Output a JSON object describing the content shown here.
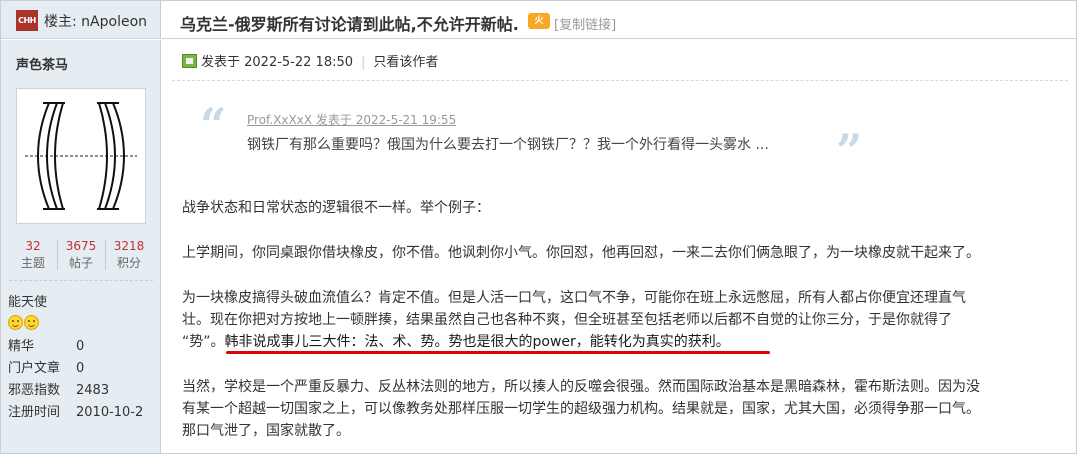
{
  "header": {
    "op_icon_text": "CHH",
    "op_label": "楼主: nApoleon",
    "thread_title": "乌克兰-俄罗斯所有讨论请到此帖,不允许开新帖.",
    "fire_icon_text": "火",
    "copy_link": "[复制链接]"
  },
  "author": {
    "name": "声色茶马",
    "stats": [
      {
        "value": "32",
        "label": "主题"
      },
      {
        "value": "3675",
        "label": "帖子"
      },
      {
        "value": "3218",
        "label": "积分"
      }
    ],
    "rank": "能天使",
    "info": [
      {
        "key": "精华",
        "value": "0"
      },
      {
        "key": "门户文章",
        "value": "0"
      },
      {
        "key": "邪恶指数",
        "value": "2483"
      },
      {
        "key": "注册时间",
        "value": "2010-10-2"
      }
    ]
  },
  "post": {
    "posted_at": "发表于 2022-5-22 18:50",
    "only_author": "只看该作者",
    "quote": {
      "author_line": "Prof.XxXxX 发表于 2022-5-21 19:55",
      "text": "钢铁厂有那么重要吗？俄国为什么要去打一个钢铁厂？？我一个外行看得一头雾水 ..."
    },
    "paragraphs": {
      "p1": "战争状态和日常状态的逻辑很不一样。举个例子：",
      "p2": "上学期间，你同桌跟你借块橡皮，你不借。他讽刺你小气。你回怼，他再回怼，一来二去你们俩急眼了，为一块橡皮就干起来了。",
      "p3_line1": "为一块橡皮搞得头破血流值么？肯定不值。但是人活一口气，这口气不争，可能你在班上永远憋屈，所有人都占你便宜还理直气",
      "p3_line2": "壮。现在你把对方按地上一顿胖揍，结果虽然自己也各种不爽，但全班甚至包括老师以后都不自觉的让你三分，于是你就得了",
      "p3_line3_a": "“势”。",
      "p3_line3_b": "韩非说成事儿三大件：法、术、势。势也是很大的power，能转化为真实的获利。",
      "p4_line1": "当然，学校是一个严重反暴力、反丛林法则的地方，所以揍人的反噬会很强。然而国际政治基本是黑暗森林，霍布斯法则。因为没",
      "p4_line2": "有某一个超越一切国家之上，可以像教务处那样压服一切学生的超级强力机构。结果就是，国家，尤其大国，必须得争那一口气。",
      "p4_line3": "那口气泄了，国家就散了。"
    }
  },
  "colors": {
    "sidebar_bg": "#e5edf2",
    "stat_number": "#c23030",
    "underline": "#e00000",
    "quote_mark": "#c9d9e6"
  }
}
